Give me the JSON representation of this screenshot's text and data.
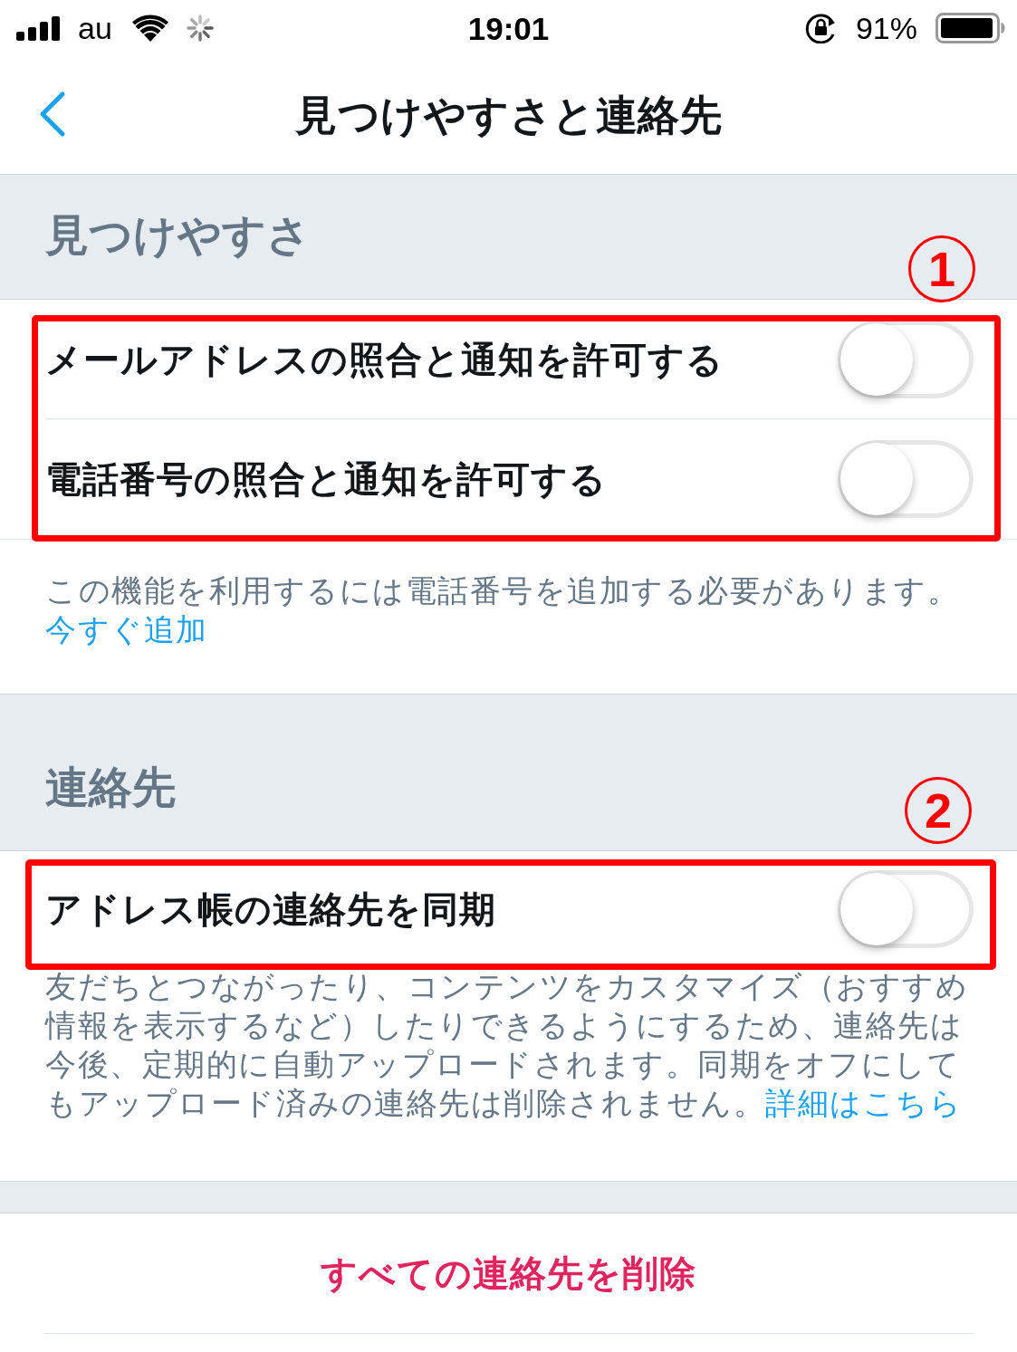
{
  "status_bar": {
    "carrier": "au",
    "time": "19:01",
    "battery_percent": "91%"
  },
  "nav_bar": {
    "title": "見つけやすさと連絡先"
  },
  "sections": [
    {
      "header": "見つけやすさ",
      "annotation": "1",
      "rows": [
        {
          "label": "メールアドレスの照合と通知を許可する",
          "on": false
        },
        {
          "label": "電話番号の照合と通知を許可する",
          "on": false
        }
      ],
      "footer": {
        "text": "この機能を利用するには電話番号を追加する必要があります。",
        "link": "今すぐ追加"
      }
    },
    {
      "header": "連絡先",
      "annotation": "2",
      "rows": [
        {
          "label": "アドレス帳の連絡先を同期",
          "on": false
        }
      ],
      "footer": {
        "text": "友だちとつながったり、コンテンツをカスタマイズ（おすすめ情報を表示するなど）したりできるようにするため、連絡先は今後、定期的に自動アップロードされます。同期をオフにしてもアップロード済みの連絡先は削除されません。",
        "link": "詳細はこちら"
      }
    }
  ],
  "action": {
    "label": "すべての連絡先を削除"
  }
}
